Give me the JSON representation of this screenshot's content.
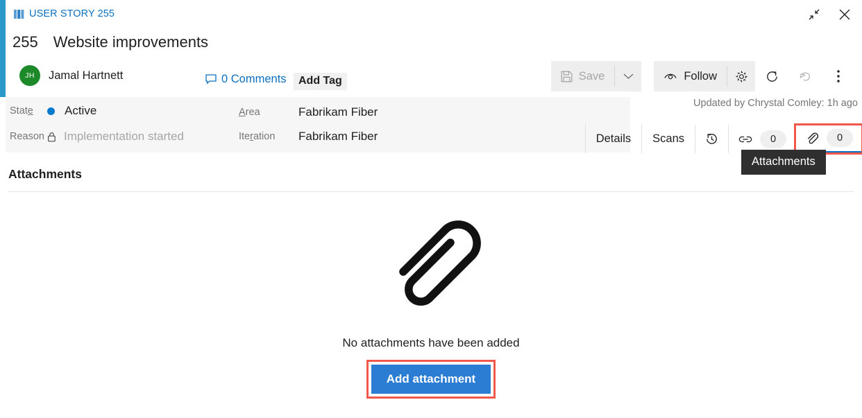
{
  "window": {
    "restore_icon": "collapse-arrows-icon",
    "close_icon": "close-icon"
  },
  "header": {
    "type_icon": "user-story-book-icon",
    "type_label": "USER STORY 255",
    "id": "255",
    "title": "Website improvements",
    "author": {
      "initials": "JH",
      "name": "Jamal Hartnett",
      "avatar_color": "#1d8a2a"
    },
    "comments_label": "0 Comments",
    "comments_icon": "comment-bubble-icon",
    "add_tag_label": "Add Tag"
  },
  "toolbar": {
    "save_label": "Save",
    "save_icon": "floppy-disk-icon",
    "save_disabled": true,
    "save_caret_icon": "chevron-down-icon",
    "follow_label": "Follow",
    "follow_icon": "eye-icon",
    "settings_icon": "gear-icon",
    "refresh_icon": "refresh-icon",
    "undo_icon": "undo-icon",
    "more_icon": "more-vertical-icon"
  },
  "fields": {
    "state": {
      "label": "State",
      "label_accesskey": "e",
      "value": "Active",
      "dot_color": "#007acc"
    },
    "reason": {
      "label": "Reason",
      "value": "Implementation started",
      "lock_icon": "lock-icon",
      "readonly": true
    },
    "area": {
      "label": "Area",
      "label_accesskey": "A",
      "value": "Fabrikam Fiber"
    },
    "iteration": {
      "label": "Iteration",
      "label_accesskey": "r",
      "value": "Fabrikam Fiber"
    }
  },
  "status": {
    "updated_by": "Updated by Chrystal Comley: 1h ago"
  },
  "tabs": [
    {
      "label": "Details",
      "type": "text"
    },
    {
      "label": "Scans",
      "type": "text"
    },
    {
      "label": "",
      "type": "icon",
      "icon": "history-icon"
    },
    {
      "label": "",
      "type": "icon",
      "icon": "link-icon",
      "count": "0"
    },
    {
      "label": "",
      "type": "icon",
      "icon": "paperclip-icon",
      "count": "0",
      "selected": true,
      "highlighted": true
    }
  ],
  "tooltip": {
    "text": "Attachments"
  },
  "attachments": {
    "section_title": "Attachments",
    "empty_icon": "large-paperclip-icon",
    "empty_message": "No attachments have been added",
    "add_button_label": "Add attachment",
    "add_button_color": "#2b7cd3",
    "highlight_color": "#f1584c"
  }
}
